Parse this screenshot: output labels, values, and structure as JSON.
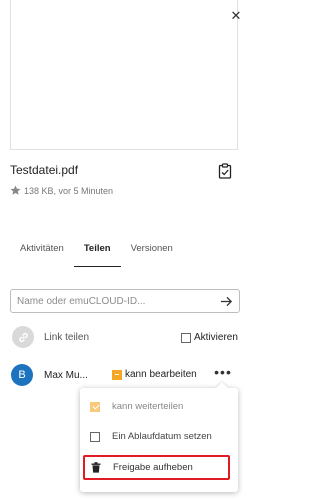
{
  "file": {
    "name": "Testdatei.pdf",
    "meta": "138 KB, vor 5 Minuten"
  },
  "tabs": [
    {
      "label": "Aktivitäten",
      "active": false
    },
    {
      "label": "Teilen",
      "active": true
    },
    {
      "label": "Versionen",
      "active": false
    }
  ],
  "search": {
    "placeholder": "Name oder emuCLOUD-ID...",
    "value": ""
  },
  "share_link": {
    "label": "Link teilen",
    "activate_label": "Aktivieren"
  },
  "share_user": {
    "avatar_initial": "B",
    "name": "Max Mu...",
    "permission_label": "kann bearbeiten"
  },
  "menu": {
    "items": [
      {
        "label": "kann weiterteilen",
        "checked": true
      },
      {
        "label": "Ein Ablaufdatum setzen",
        "checked": false
      }
    ],
    "delete_label": "Freigabe aufheben"
  },
  "colors": {
    "accent_orange": "#f5a623",
    "avatar_blue": "#1e73be",
    "highlight_red": "#e01b24"
  }
}
